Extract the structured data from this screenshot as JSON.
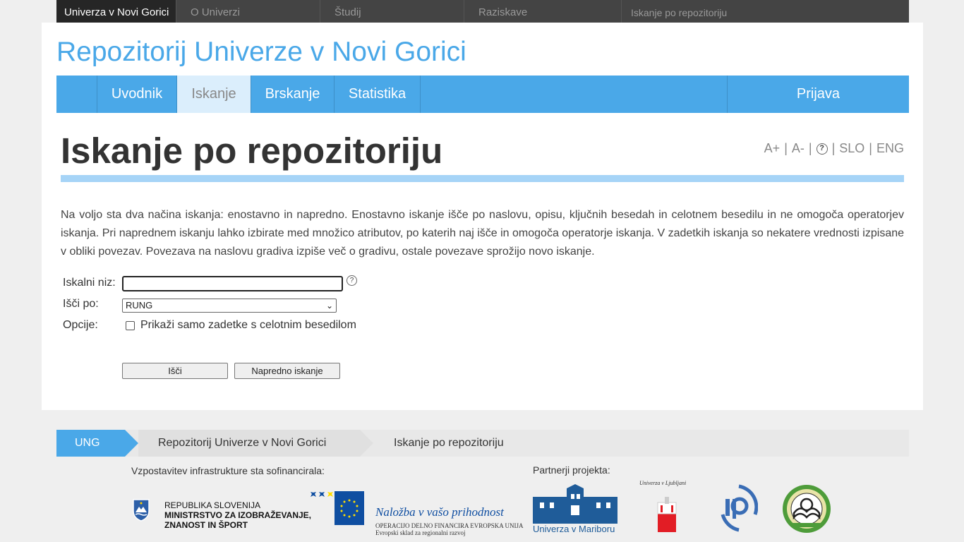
{
  "topbar": {
    "items": [
      "Univerza v Novi Gorici",
      "O Univerzi",
      "Študij",
      "Raziskave",
      "Iskanje po repozitoriju"
    ]
  },
  "repo_title": "Repozitorij Univerze v Novi Gorici",
  "nav": {
    "tabs": [
      "Uvodnik",
      "Iskanje",
      "Brskanje",
      "Statistika"
    ],
    "login": "Prijava"
  },
  "heading": "Iskanje po repozitoriju",
  "tools": {
    "larger": "A+",
    "smaller": "A-",
    "help": "?",
    "slo": "SLO",
    "eng": "ENG"
  },
  "intro": "Na voljo sta dva načina iskanja: enostavno in napredno. Enostavno iskanje išče po naslovu, opisu, ključnih besedah in celotnem besedilu in ne omogoča operatorjev iskanja. Pri naprednem iskanju lahko izbirate med množico atributov, po katerih naj išče in omogoča operatorje iskanja. V zadetkih iskanja so nekatere vrednosti izpisane v obliki povezav. Povezava na naslovu gradiva izpiše več o gradivu, ostale povezave sprožijo novo iskanje.",
  "form": {
    "query_label": "Iskalni niz:",
    "query_value": "",
    "help": "?",
    "scope_label": "Išči po:",
    "scope_value": "RUNG",
    "options_label": "Opcije:",
    "fulltext_label": "Prikaži samo zadetke s celotnim besedilom",
    "search_button": "Išči",
    "advanced_button": "Napredno iskanje"
  },
  "breadcrumb": [
    "UNG",
    "Repozitorij Univerze v Novi Gorici",
    "Iskanje po repozitoriju"
  ],
  "footer": {
    "cofinance_title": "Vzpostavitev infrastrukture sta sofinancirala:",
    "partners_title": "Partnerji projekta:",
    "ministry_lines": [
      "REPUBLIKA SLOVENIJA",
      "MINISTRSTVO ZA IZOBRAŽEVANJE,",
      "ZNANOST IN ŠPORT"
    ],
    "eu_slogan": "Naložba v vašo prihodnost",
    "eu_lines": [
      "OPERACIJO DELNO FINANCIRA EVROPSKA UNIJA",
      "Evropski sklad za regionalni razvoj"
    ],
    "maribor": "Univerza v Mariboru",
    "ljubljana": "Univerza v Ljubljani",
    "colors": {
      "accent": "#4aa8e8",
      "eu_blue": "#0f4ea1",
      "eu_yellow": "#ffdd00",
      "lj_red": "#e21d25"
    }
  }
}
